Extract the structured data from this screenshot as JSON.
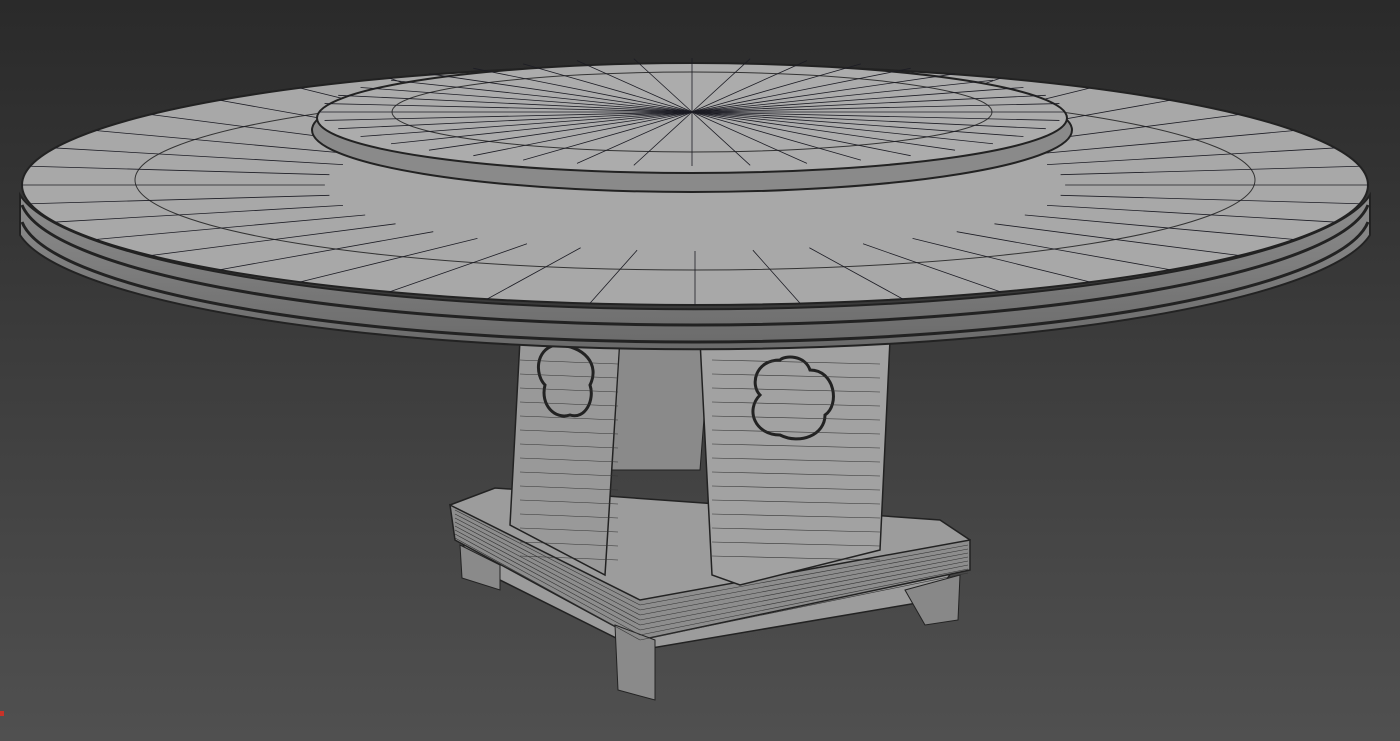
{
  "viewport": {
    "background_top": "#2a2a2a",
    "background_bottom": "#505050",
    "model_fill": "#a9a9a9",
    "wire_color": "#1c1c24",
    "axis_gizmo_color": "#c83228",
    "radial_segments": 40
  }
}
